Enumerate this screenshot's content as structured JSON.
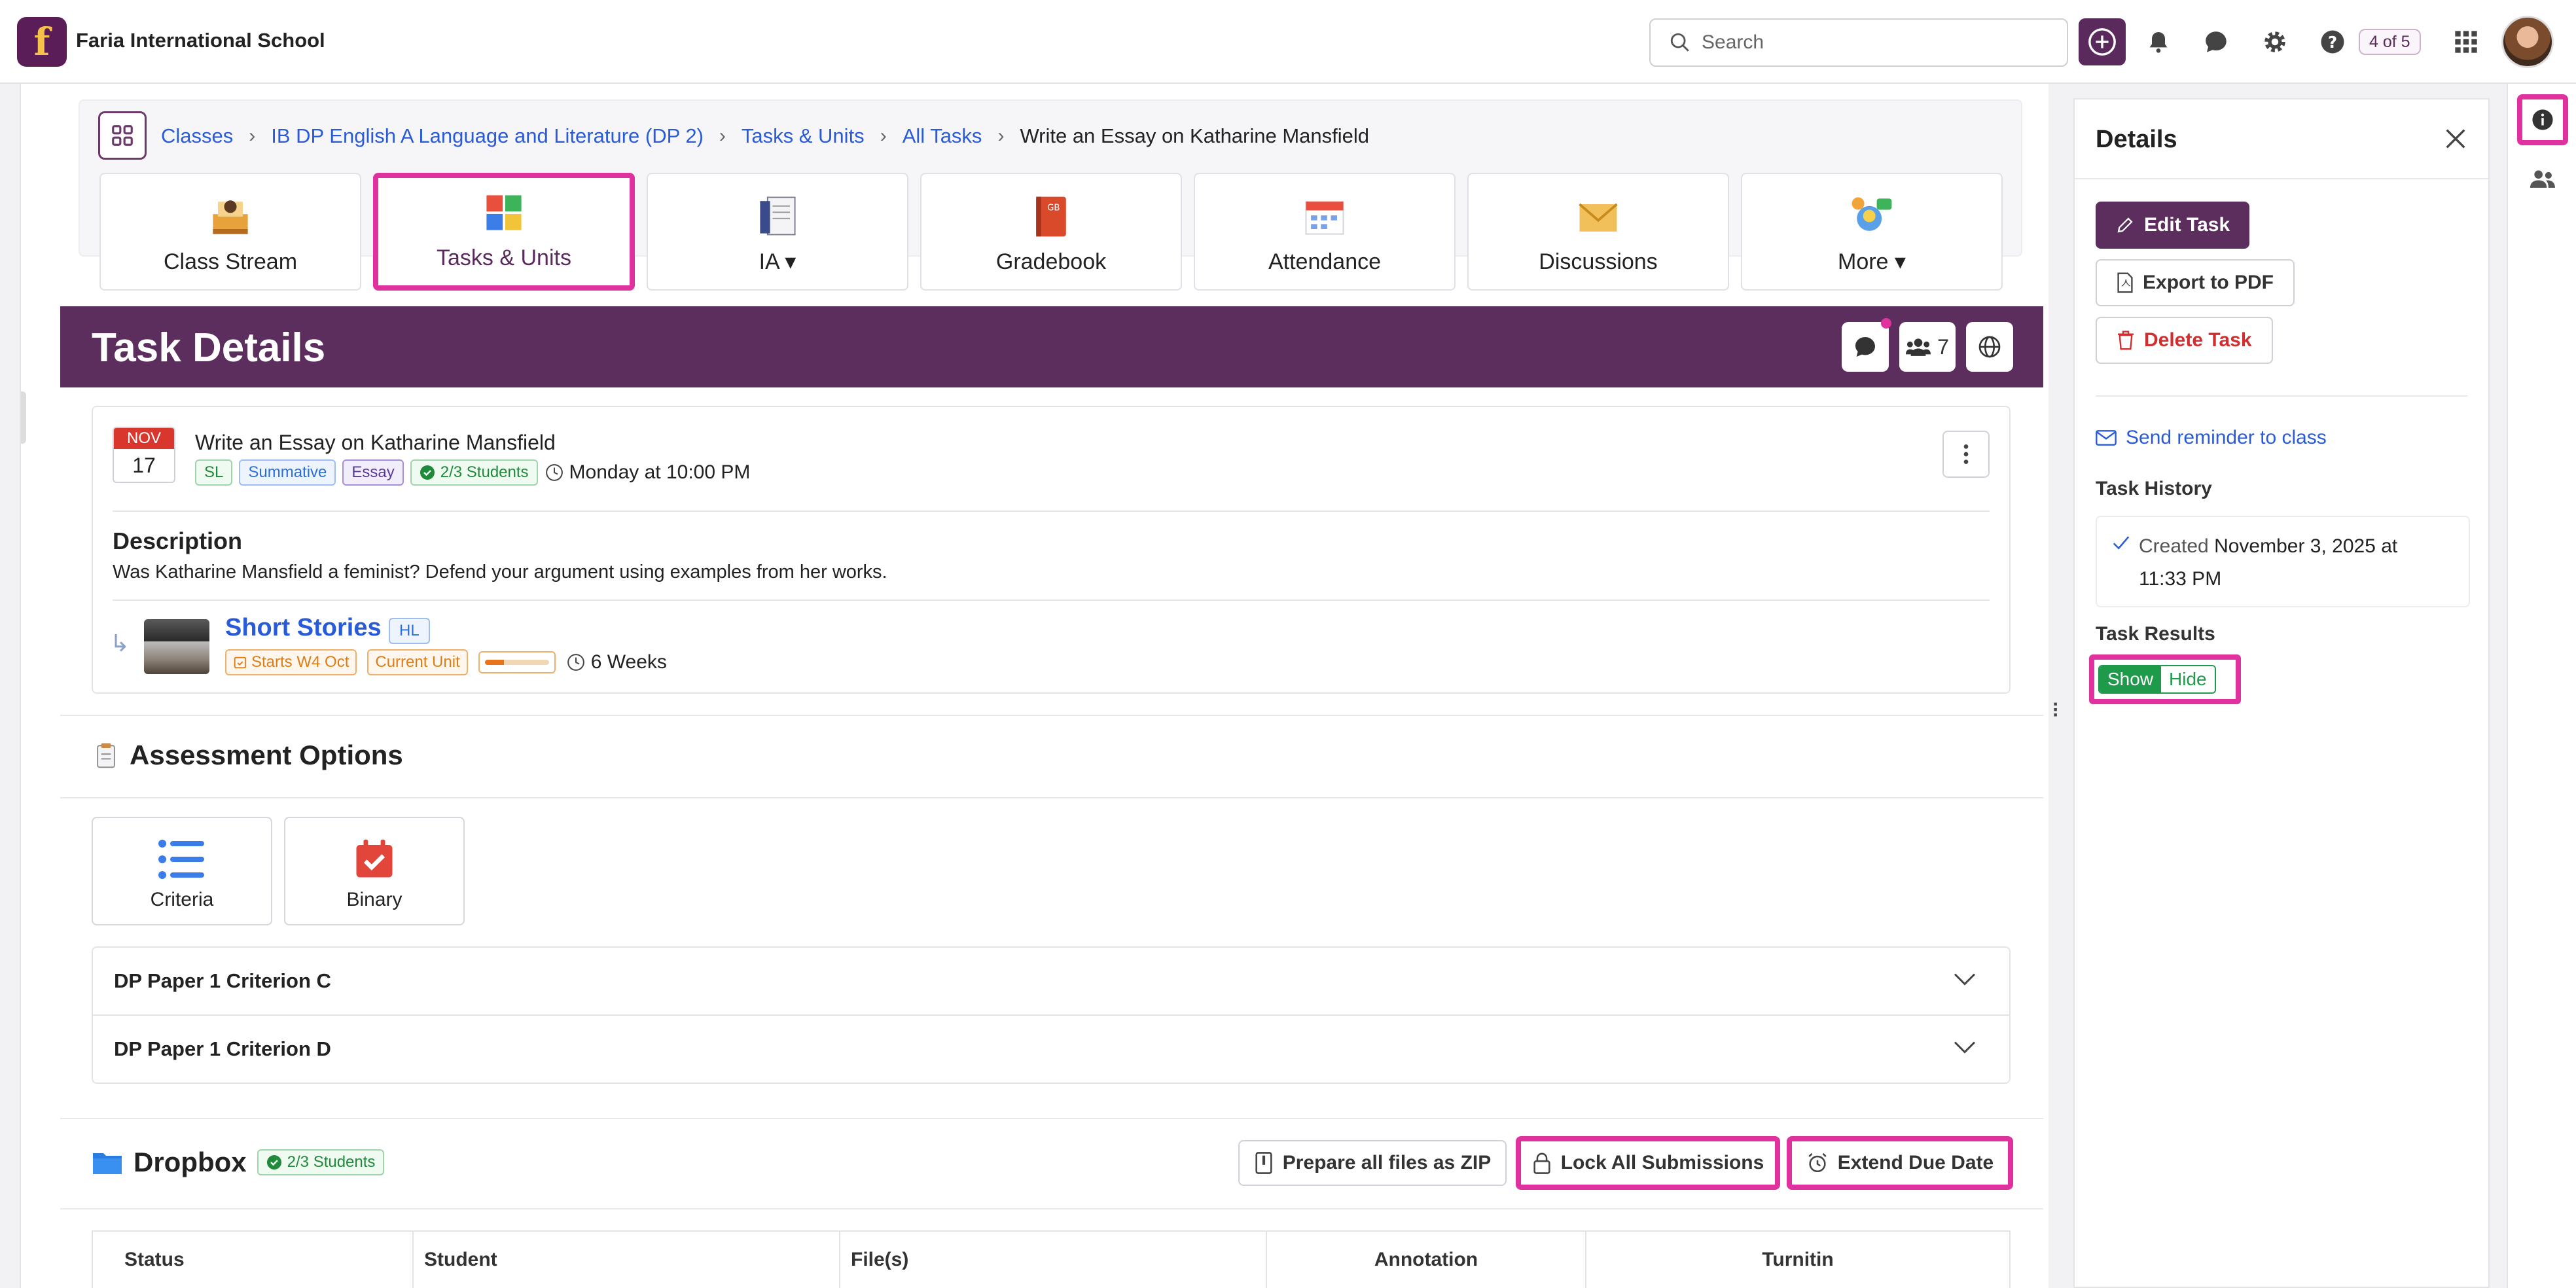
{
  "topbar": {
    "school_name": "Faria International School",
    "logo_letter": "f",
    "search_placeholder": "Search",
    "pager": "4 of 5",
    "icons": [
      "plus-circle-icon",
      "bell-icon",
      "chat-icon",
      "gear-icon",
      "help-icon",
      "apps-grid-icon"
    ]
  },
  "breadcrumb": {
    "items": [
      "Classes",
      "IB DP English A Language and Literature (DP 2)",
      "Tasks & Units",
      "All Tasks"
    ],
    "current": "Write an Essay on Katharine Mansfield"
  },
  "tiles": [
    {
      "label": "Class Stream",
      "icon": "class-stream-icon"
    },
    {
      "label": "Tasks & Units",
      "icon": "puzzle-icon",
      "active": true
    },
    {
      "label": "IA",
      "icon": "ia-notebook-icon",
      "dropdown": true
    },
    {
      "label": "Gradebook",
      "icon": "gradebook-icon"
    },
    {
      "label": "Attendance",
      "icon": "calendar-icon"
    },
    {
      "label": "Discussions",
      "icon": "envelope-icon"
    },
    {
      "label": "More",
      "icon": "more-bulb-icon",
      "dropdown": true
    }
  ],
  "banner": {
    "title": "Task Details",
    "members_count": "7"
  },
  "task": {
    "month": "NOV",
    "day": "17",
    "title": "Write an Essay on Katharine Mansfield",
    "tags": [
      "SL",
      "Summative",
      "Essay"
    ],
    "students": "2/3 Students",
    "due": "Monday at 10:00 PM",
    "description_heading": "Description",
    "description": "Was Katharine Mansfield a feminist? Defend your argument using examples from her works."
  },
  "unit": {
    "title": "Short Stories",
    "level": "HL",
    "starts": "Starts W4 Oct",
    "status": "Current Unit",
    "progress": 0.3,
    "duration": "6 Weeks"
  },
  "assessment": {
    "heading": "Assessment Options",
    "options": [
      "Criteria",
      "Binary"
    ],
    "criteria": [
      "DP Paper 1 Criterion C",
      "DP Paper 1 Criterion D"
    ]
  },
  "dropbox": {
    "heading": "Dropbox",
    "students": "2/3 Students",
    "buttons": {
      "zip": "Prepare all files as ZIP",
      "lock": "Lock All Submissions",
      "extend": "Extend Due Date"
    },
    "columns": [
      "Status",
      "Student",
      "File(s)",
      "Annotation",
      "Turnitin"
    ]
  },
  "details": {
    "title": "Details",
    "edit": "Edit Task",
    "export": "Export to PDF",
    "delete": "Delete Task",
    "reminder": "Send reminder to class",
    "history_label": "Task History",
    "created_label": "Created",
    "created_date": "November 3, 2025 at",
    "created_time": "11:33 PM",
    "results_label": "Task Results",
    "show": "Show",
    "hide": "Hide"
  },
  "colors": {
    "brand": "#5b2e5d",
    "highlight": "#e0329e",
    "link": "#2a5bd7",
    "success": "#1f9a4a",
    "danger": "#d12f2f"
  }
}
